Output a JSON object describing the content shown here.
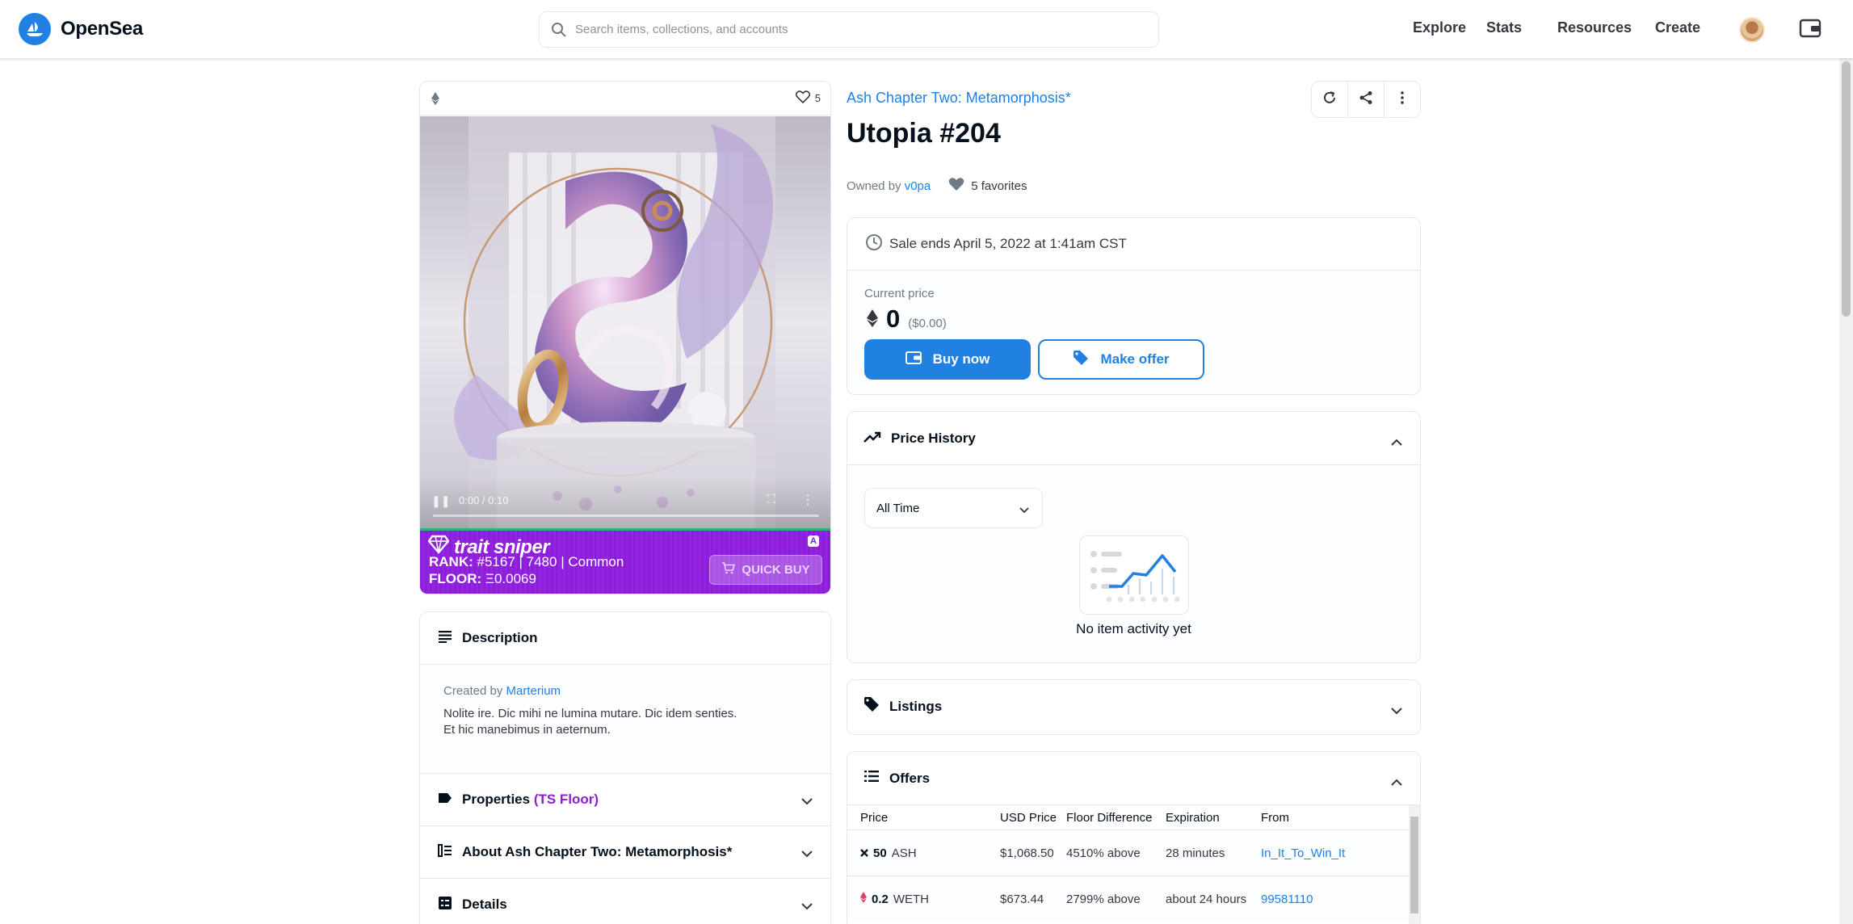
{
  "header": {
    "brand": "OpenSea",
    "search_placeholder": "Search items, collections, and accounts",
    "nav": [
      "Explore",
      "Stats",
      "Resources",
      "Create"
    ]
  },
  "media": {
    "favorites_count": "5",
    "video_time": "0:00 / 0:10"
  },
  "trait_sniper": {
    "brand": "trait sniper",
    "rank_label": "RANK:",
    "rank_value": "#5167 | 7480 | Common",
    "floor_label": "FLOOR:",
    "floor_value": "Ξ0.0069",
    "quick_buy": "QUICK BUY",
    "badge": "A"
  },
  "description": {
    "heading": "Description",
    "created_by_label": "Created by",
    "creator": "Marterium",
    "line1": "Nolite ire. Dic mihi ne lumina mutare. Dic idem senties.",
    "line2": "Et hic manebimus in aeternum."
  },
  "accordions": {
    "properties": "Properties",
    "properties_extra": "(TS Floor)",
    "about": "About Ash Chapter Two: Metamorphosis*",
    "details": "Details"
  },
  "item": {
    "collection": "Ash Chapter Two: Metamorphosis*",
    "title": "Utopia #204",
    "owned_by_label": "Owned by",
    "owner": "v0pa",
    "favorites": "5 favorites"
  },
  "sale": {
    "ends_text": "Sale ends April 5, 2022 at 1:41am CST",
    "current_price_label": "Current price",
    "price": "0",
    "price_usd": "($0.00)",
    "buy_now": "Buy now",
    "make_offer": "Make offer"
  },
  "price_history": {
    "heading": "Price History",
    "filter": "All Time",
    "empty": "No item activity yet"
  },
  "listings": {
    "heading": "Listings"
  },
  "offers": {
    "heading": "Offers",
    "columns": [
      "Price",
      "USD Price",
      "Floor Difference",
      "Expiration",
      "From"
    ],
    "rows": [
      {
        "amount": "50",
        "currency": "ASH",
        "usd": "$1,068.50",
        "floor_diff": "4510% above",
        "expiration": "28 minutes",
        "from": "In_It_To_Win_It"
      },
      {
        "amount": "0.2",
        "currency": "WETH",
        "usd": "$673.44",
        "floor_diff": "2799% above",
        "expiration": "about 24 hours",
        "from": "99581110"
      }
    ]
  },
  "colors": {
    "accent": "#2081e2",
    "trait_purple": "#9423e2",
    "text": "#04111d",
    "muted": "#707a83"
  }
}
